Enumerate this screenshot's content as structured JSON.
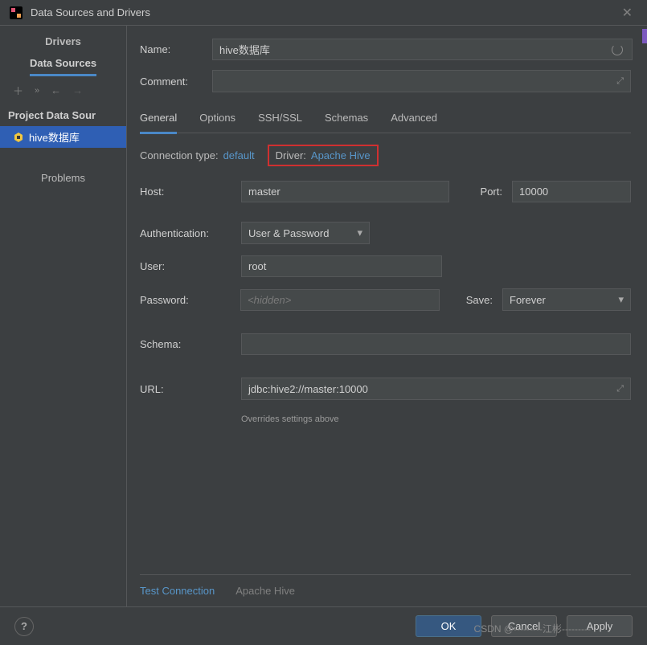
{
  "window": {
    "title": "Data Sources and Drivers"
  },
  "sidebar": {
    "categories": {
      "drivers": "Drivers",
      "data_sources": "Data Sources"
    },
    "heading": "Project Data Sour",
    "item_label": "hive数据库",
    "problems": "Problems"
  },
  "form": {
    "name_label": "Name:",
    "name_value": "hive数据库",
    "comment_label": "Comment:"
  },
  "tabs": {
    "general": "General",
    "options": "Options",
    "ssh": "SSH/SSL",
    "schemas": "Schemas",
    "advanced": "Advanced"
  },
  "conn": {
    "type_label": "Connection type:",
    "type_value": "default",
    "driver_label": "Driver:",
    "driver_value": "Apache Hive"
  },
  "fields": {
    "host_label": "Host:",
    "host_value": "master",
    "port_label": "Port:",
    "port_value": "10000",
    "auth_label": "Authentication:",
    "auth_value": "User & Password",
    "user_label": "User:",
    "user_value": "root",
    "password_label": "Password:",
    "password_placeholder": "<hidden>",
    "save_label": "Save:",
    "save_value": "Forever",
    "schema_label": "Schema:",
    "url_label": "URL:",
    "url_value": "jdbc:hive2://master:10000",
    "url_hint": "Overrides settings above"
  },
  "bottom": {
    "test": "Test Connection",
    "driver": "Apache Hive"
  },
  "footer": {
    "ok": "OK",
    "cancel": "Cancel",
    "apply": "Apply"
  },
  "watermark": "CSDN @---------江彬---------"
}
